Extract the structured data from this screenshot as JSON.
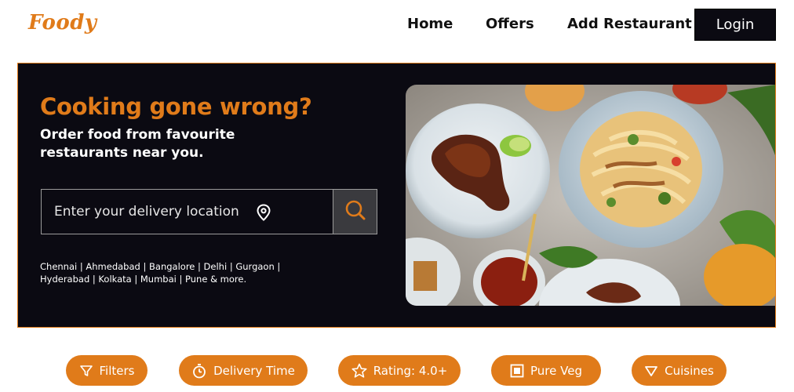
{
  "nav": {
    "logo": "Foody",
    "links": [
      "Home",
      "Offers",
      "Add Restaurant"
    ],
    "login_label": "Login"
  },
  "hero": {
    "title": "Cooking gone wrong?",
    "subtitle": "Order food from favourite restaurants near you.",
    "search_placeholder": "Enter your delivery location",
    "cities": "Chennai | Ahmedabad | Bangalore | Delhi | Gurgaon | Hyderabad | Kolkata | Mumbai | Pune & more."
  },
  "filters": [
    {
      "label": "Filters",
      "icon": "funnel-icon"
    },
    {
      "label": "Delivery Time",
      "icon": "stopwatch-icon"
    },
    {
      "label": "Rating: 4.0+",
      "icon": "star-icon"
    },
    {
      "label": "Pure Veg",
      "icon": "veg-icon"
    },
    {
      "label": "Cuisines",
      "icon": "chevron-down-icon"
    }
  ],
  "colors": {
    "accent": "#e07b1a",
    "hero_bg": "#0b0a12",
    "text_dark": "#111111"
  }
}
